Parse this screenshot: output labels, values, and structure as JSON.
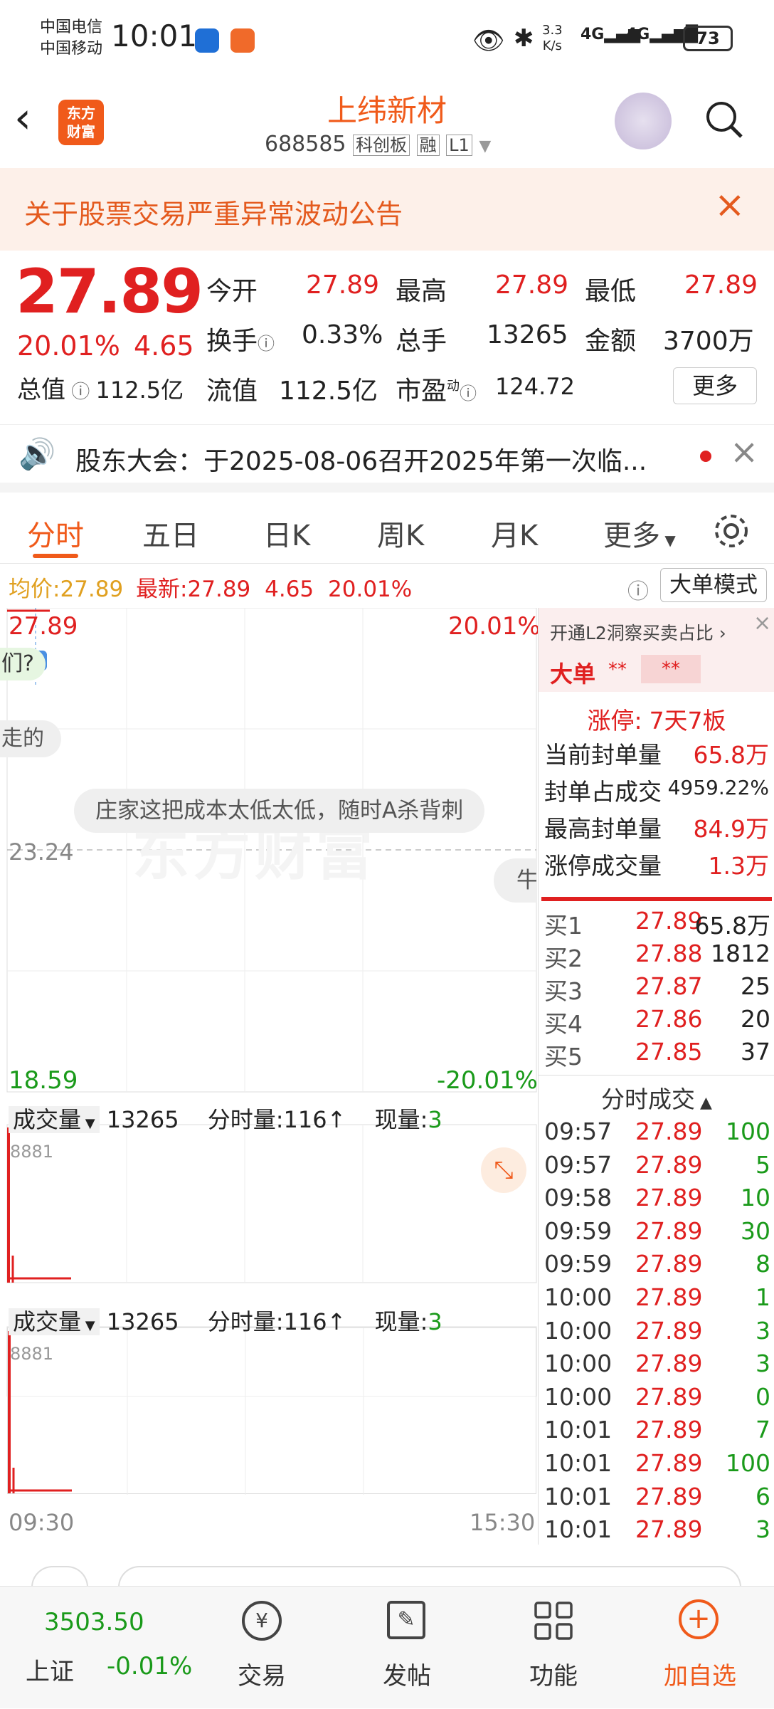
{
  "status": {
    "carrier1": "中国电信",
    "carrier2": "中国移动",
    "time": "10:01",
    "speed_top": "3.3",
    "speed_bottom": "K/s",
    "net1": "4G",
    "net2": "4G",
    "battery": "73"
  },
  "header": {
    "name": "上纬新材",
    "code": "688585",
    "board": "科创板",
    "margin": "融",
    "level": "L1",
    "logo_top": "东方",
    "logo_bottom": "财富"
  },
  "notice": {
    "text": "关于股票交易严重异常波动公告"
  },
  "quote": {
    "price": "27.89",
    "change_pct": "20.01%",
    "change_amt": "4.65",
    "open_label": "今开",
    "open": "27.89",
    "high_label": "最高",
    "high": "27.89",
    "low_label": "最低",
    "low": "27.89",
    "turnover_label": "换手",
    "turnover": "0.33%",
    "vol_label": "总手",
    "vol": "13265",
    "amount_label": "金额",
    "amount": "3700万",
    "mcap_label": "总值",
    "mcap": "112.5亿",
    "float_label": "流值",
    "float": "112.5亿",
    "pe_label": "市盈",
    "pe_sup": "动",
    "pe": "124.72",
    "more": "更多"
  },
  "announcement": {
    "text": "股东大会：于2025-08-06召开2025年第一次临..."
  },
  "tabs": [
    "分时",
    "五日",
    "日K",
    "周K",
    "月K",
    "更多"
  ],
  "infobar": {
    "avg_label": "均价:",
    "avg": "27.89",
    "latest_label": "最新:",
    "latest": "27.89",
    "chg": "4.65",
    "pct": "20.01%",
    "mode": "大单模式"
  },
  "chart": {
    "top_price": "27.89",
    "top_pct": "20.01%",
    "mid_price": "23.24",
    "bottom_price": "18.59",
    "bottom_pct": "-20.01%",
    "bubble1": "庄家这把成本太低太低，随时A杀背刺",
    "bubble2": "走的",
    "bubble3": "们?",
    "bubble4": "牛",
    "start_time": "09:30",
    "end_time": "15:30",
    "watermark": "东方财富"
  },
  "volume": {
    "label": "成交量",
    "total": "13265",
    "min_label": "分时量:116↑",
    "cur_label": "现量:",
    "cur": "3",
    "max": "8881"
  },
  "panel": {
    "l2_link": "开通L2洞察买卖占比",
    "big_label": "大单",
    "big_v1": "**",
    "big_v2": "**",
    "limit_label": "涨停:",
    "limit": "7天7板",
    "stats": [
      {
        "k": "当前封单量",
        "v": "65.8万"
      },
      {
        "k": "封单占成交",
        "v": "4959.22%"
      },
      {
        "k": "最高封单量",
        "v": "84.9万"
      },
      {
        "k": "涨停成交量",
        "v": "1.3万"
      }
    ],
    "bids": [
      {
        "k": "买1",
        "p": "27.89",
        "v": "65.8万"
      },
      {
        "k": "买2",
        "p": "27.88",
        "v": "1812"
      },
      {
        "k": "买3",
        "p": "27.87",
        "v": "25"
      },
      {
        "k": "买4",
        "p": "27.86",
        "v": "20"
      },
      {
        "k": "买5",
        "p": "27.85",
        "v": "37"
      }
    ],
    "trades_title": "分时成交",
    "trades": [
      {
        "t": "09:57",
        "p": "27.89",
        "v": "100"
      },
      {
        "t": "09:57",
        "p": "27.89",
        "v": "5"
      },
      {
        "t": "09:58",
        "p": "27.89",
        "v": "10"
      },
      {
        "t": "09:59",
        "p": "27.89",
        "v": "30"
      },
      {
        "t": "09:59",
        "p": "27.89",
        "v": "8"
      },
      {
        "t": "10:00",
        "p": "27.89",
        "v": "1"
      },
      {
        "t": "10:00",
        "p": "27.89",
        "v": "3"
      },
      {
        "t": "10:00",
        "p": "27.89",
        "v": "3"
      },
      {
        "t": "10:00",
        "p": "27.89",
        "v": "0"
      },
      {
        "t": "10:01",
        "p": "27.89",
        "v": "7"
      },
      {
        "t": "10:01",
        "p": "27.89",
        "v": "100"
      },
      {
        "t": "10:01",
        "p": "27.89",
        "v": "6"
      },
      {
        "t": "10:01",
        "p": "27.89",
        "v": "3"
      }
    ]
  },
  "bottom": {
    "index_value": "3503.50",
    "index_name": "上证",
    "index_chg": "-0.01%",
    "trade": "交易",
    "post": "发帖",
    "func": "功能",
    "add": "加自选"
  },
  "colors": {
    "up": "#e02020",
    "down": "#1a9a1a",
    "accent": "#f05a1a"
  }
}
